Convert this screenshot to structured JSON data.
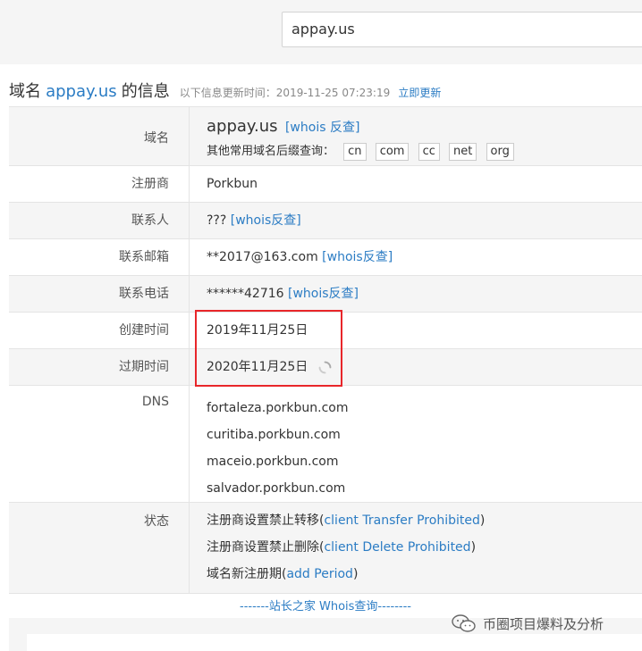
{
  "search": {
    "value": "appay.us"
  },
  "heading": {
    "prefix": "域名",
    "domain": "appay.us",
    "suffix": "的信息",
    "update_note": "以下信息更新时间：2019-11-25 07:23:19",
    "refresh_link": "立即更新"
  },
  "domain_row": {
    "label": "域名",
    "value": "appay.us",
    "whois_link": "[whois 反查]",
    "suffix_label": "其他常用域名后缀查询：",
    "suffixes": [
      "cn",
      "com",
      "cc",
      "net",
      "org"
    ]
  },
  "registrar": {
    "label": "注册商",
    "value": "Porkbun"
  },
  "contact": {
    "label": "联系人",
    "value": "???",
    "link": "[whois反查]"
  },
  "email": {
    "label": "联系邮箱",
    "value": "**2017@163.com",
    "link": "[whois反查]"
  },
  "phone": {
    "label": "联系电话",
    "value": "******42716",
    "link": "[whois反查]"
  },
  "created": {
    "label": "创建时间",
    "value": "2019年11月25日"
  },
  "expires": {
    "label": "过期时间",
    "value": "2020年11月25日"
  },
  "dns": {
    "label": "DNS",
    "servers": [
      "fortaleza.porkbun.com",
      "curitiba.porkbun.com",
      "maceio.porkbun.com",
      "salvador.porkbun.com"
    ]
  },
  "status": {
    "label": "状态",
    "items": [
      {
        "text": "注册商设置禁止转移",
        "code": "client Transfer Prohibited"
      },
      {
        "text": "注册商设置禁止删除",
        "code": "client Delete Prohibited"
      },
      {
        "text": "域名新注册期",
        "code": "add Period"
      }
    ]
  },
  "footer": {
    "text": "-------站长之家 Whois查询--------"
  },
  "watermark": {
    "text": "币圈项目爆料及分析"
  },
  "colors": {
    "link": "#2b7cc4",
    "highlight_box": "#e8262a",
    "alt_row": "#f5f5f5"
  }
}
